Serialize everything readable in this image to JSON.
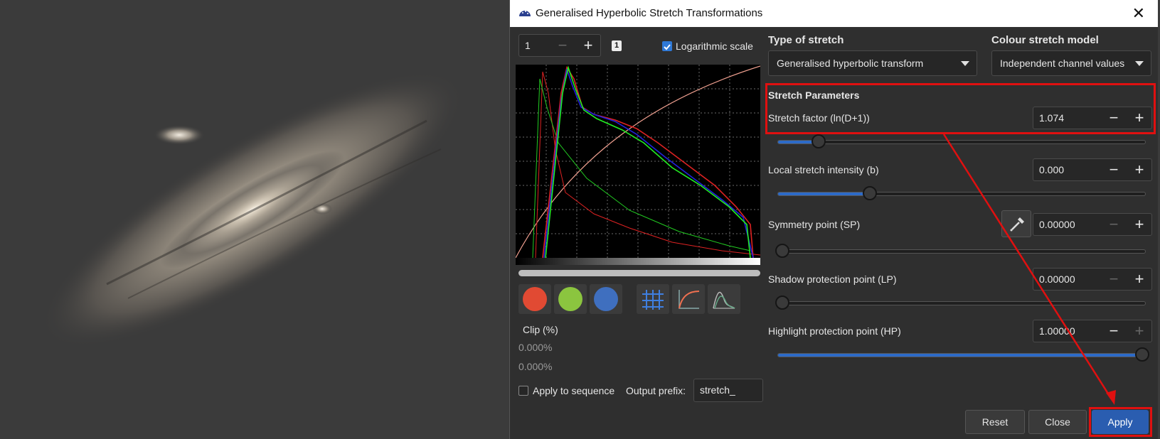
{
  "title": "Generalised Hyperbolic Stretch Transformations",
  "histogram_controls": {
    "zoom_value": "1",
    "zoom_badge": "1",
    "log_scale_label": "Logarithmic scale",
    "log_scale_checked": true
  },
  "channels": {
    "red": "#e14a33",
    "green": "#8bc53f",
    "blue": "#3f6fbf"
  },
  "clip": {
    "label": "Clip (%)",
    "low": "0.000%",
    "high": "0.000%"
  },
  "sequence": {
    "apply_label": "Apply to sequence",
    "apply_checked": false,
    "prefix_label": "Output prefix:",
    "prefix_value": "stretch_"
  },
  "stretch_type": {
    "label": "Type of stretch",
    "value": "Generalised hyperbolic transform"
  },
  "colour_model": {
    "label": "Colour stretch model",
    "value": "Independent channel values"
  },
  "params": {
    "header": "Stretch Parameters",
    "stretch_factor": {
      "label": "Stretch factor (ln(D+1))",
      "value": "1.074",
      "level": 0.11
    },
    "local_intensity": {
      "label": "Local stretch intensity (b)",
      "value": "0.000",
      "level": 0.25
    },
    "symmetry": {
      "label": "Symmetry point (SP)",
      "value": "0.00000",
      "level": 0.0
    },
    "shadow": {
      "label": "Shadow protection point (LP)",
      "value": "0.00000",
      "level": 0.0
    },
    "highlight": {
      "label": "Highlight protection point (HP)",
      "value": "1.00000",
      "level": 1.0
    }
  },
  "buttons": {
    "reset": "Reset",
    "close": "Close",
    "apply": "Apply"
  },
  "accent": "#2a5db0",
  "highlight_color": "#e01010"
}
